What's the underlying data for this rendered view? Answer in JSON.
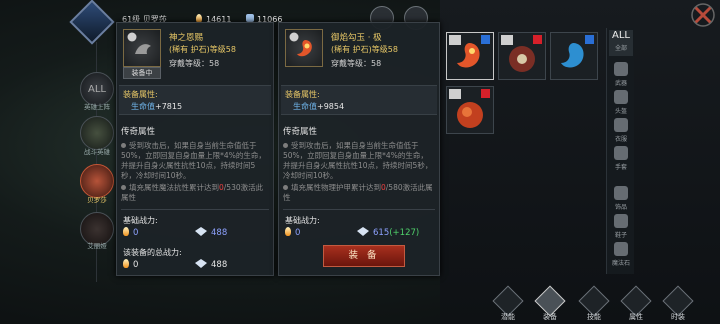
{
  "top": {
    "player_info": "61级 贝罗莎",
    "fire_power": "14611",
    "shield_power": "11066"
  },
  "heroes": [
    {
      "label": "ALL",
      "sub": "英雄上阵"
    },
    {
      "label": "",
      "sub": "战斗英雄"
    },
    {
      "label": "",
      "sub": "贝罗莎"
    },
    {
      "label": "",
      "sub": "艾丽娅"
    }
  ],
  "panel_current": {
    "name": "神之恩赐",
    "rarity_line": "(稀有 护石)等级58",
    "wear_level": "穿戴等级：58",
    "equipped_label": "装备中",
    "attr_header": "装备属性:",
    "attr_label": "生命值",
    "attr_value": "+7815",
    "legend_header": "传奇属性",
    "legend_text_1": "受到攻击后，如果自身当前生命值低于50%，立即回复自身血量上限*4%的生命，并提升自身火属性抗性10点，持续时间5秒，冷却时间10秒。",
    "legend_text_2a": "填充属性魔法抗性累计达到",
    "legend_text_2b": "0",
    "legend_text_2c": "/530激活此属性",
    "base_power_label": "基础战力:",
    "base_fire": "0",
    "base_shield": "488",
    "total_label": "该装备的总战力:",
    "total_fire": "0",
    "total_shield": "488"
  },
  "panel_compare": {
    "name": "御焰勾玉 · 极",
    "rarity_line": "(稀有 护石)等级58",
    "wear_level": "穿戴等级：58",
    "attr_header": "装备属性:",
    "attr_label": "生命值",
    "attr_value": "+9854",
    "legend_header": "传奇属性",
    "legend_text_1": "受到攻击后，如果自身当前生命值低于50%，立即回复自身血量上限*4%的生命，并提升自身火属性抗性10点，持续时间5秒，冷却时间10秒。",
    "legend_text_2a": "填充属性物理护甲累计达到",
    "legend_text_2b": "0",
    "legend_text_2c": "/580激活此属性",
    "base_power_label": "基础战力:",
    "base_fire": "0",
    "base_shield": "615",
    "base_delta": "(+127)",
    "equip_button": "装 备"
  },
  "rail": [
    {
      "label": "ALL",
      "sub": "全部"
    },
    {
      "label": "",
      "sub": "武器"
    },
    {
      "label": "",
      "sub": "头盔"
    },
    {
      "label": "",
      "sub": "衣服"
    },
    {
      "label": "",
      "sub": "手套"
    },
    {
      "label": "",
      "sub": "饰品"
    },
    {
      "label": "",
      "sub": "鞋子"
    },
    {
      "label": "",
      "sub": "魔法石"
    }
  ],
  "nav": [
    {
      "label": "潜能"
    },
    {
      "label": "装备"
    },
    {
      "label": "技能"
    },
    {
      "label": "属性"
    },
    {
      "label": "时装"
    }
  ],
  "colors": {
    "gold": "#e8c867",
    "blue": "#6fb3e8",
    "red": "#ee4040",
    "green": "#4fd06a",
    "button": "#8f2414"
  }
}
